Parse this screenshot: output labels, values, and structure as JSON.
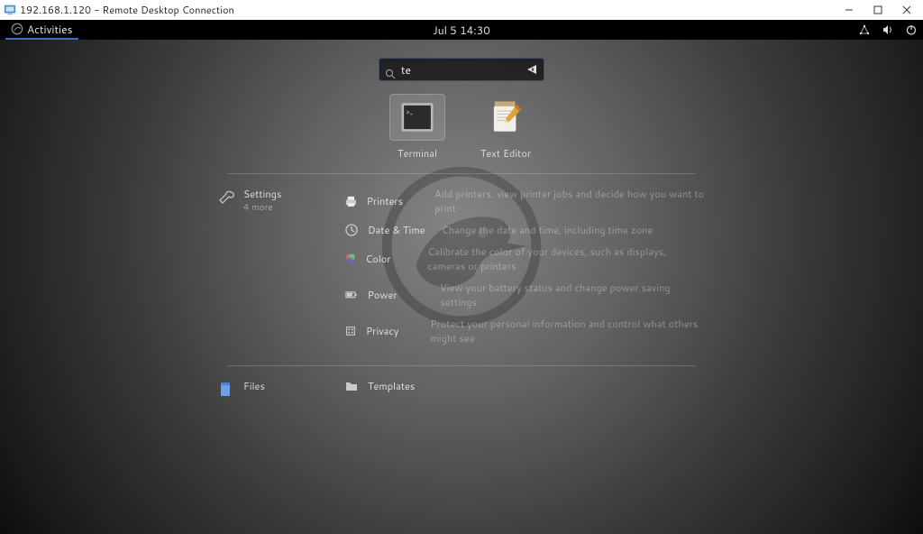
{
  "window": {
    "title": "192.168.1.120 - Remote Desktop Connection"
  },
  "panel": {
    "activities_label": "Activities",
    "clock": "Jul 5  14:30"
  },
  "search": {
    "value": "te"
  },
  "apps": [
    {
      "label": "Terminal",
      "icon": "terminal"
    },
    {
      "label": "Text Editor",
      "icon": "text-editor"
    }
  ],
  "settings_header": {
    "label": "Settings",
    "subtitle": "4 more"
  },
  "settings": [
    {
      "key": "printers",
      "label": "Printers",
      "desc": "Add printers, view printer jobs and decide how you want to print"
    },
    {
      "key": "datetime",
      "label": "Date & Time",
      "desc": "Change the date and time, including time zone"
    },
    {
      "key": "color",
      "label": "Color",
      "desc": "Calibrate the color of your devices, such as displays, cameras or printers"
    },
    {
      "key": "power",
      "label": "Power",
      "desc": "View your battery status and change power saving settings"
    },
    {
      "key": "privacy",
      "label": "Privacy",
      "desc": "Protect your personal information and control what others might see"
    }
  ],
  "files_header": {
    "label": "Files"
  },
  "files": [
    {
      "key": "templates",
      "label": "Templates",
      "desc": ""
    }
  ]
}
